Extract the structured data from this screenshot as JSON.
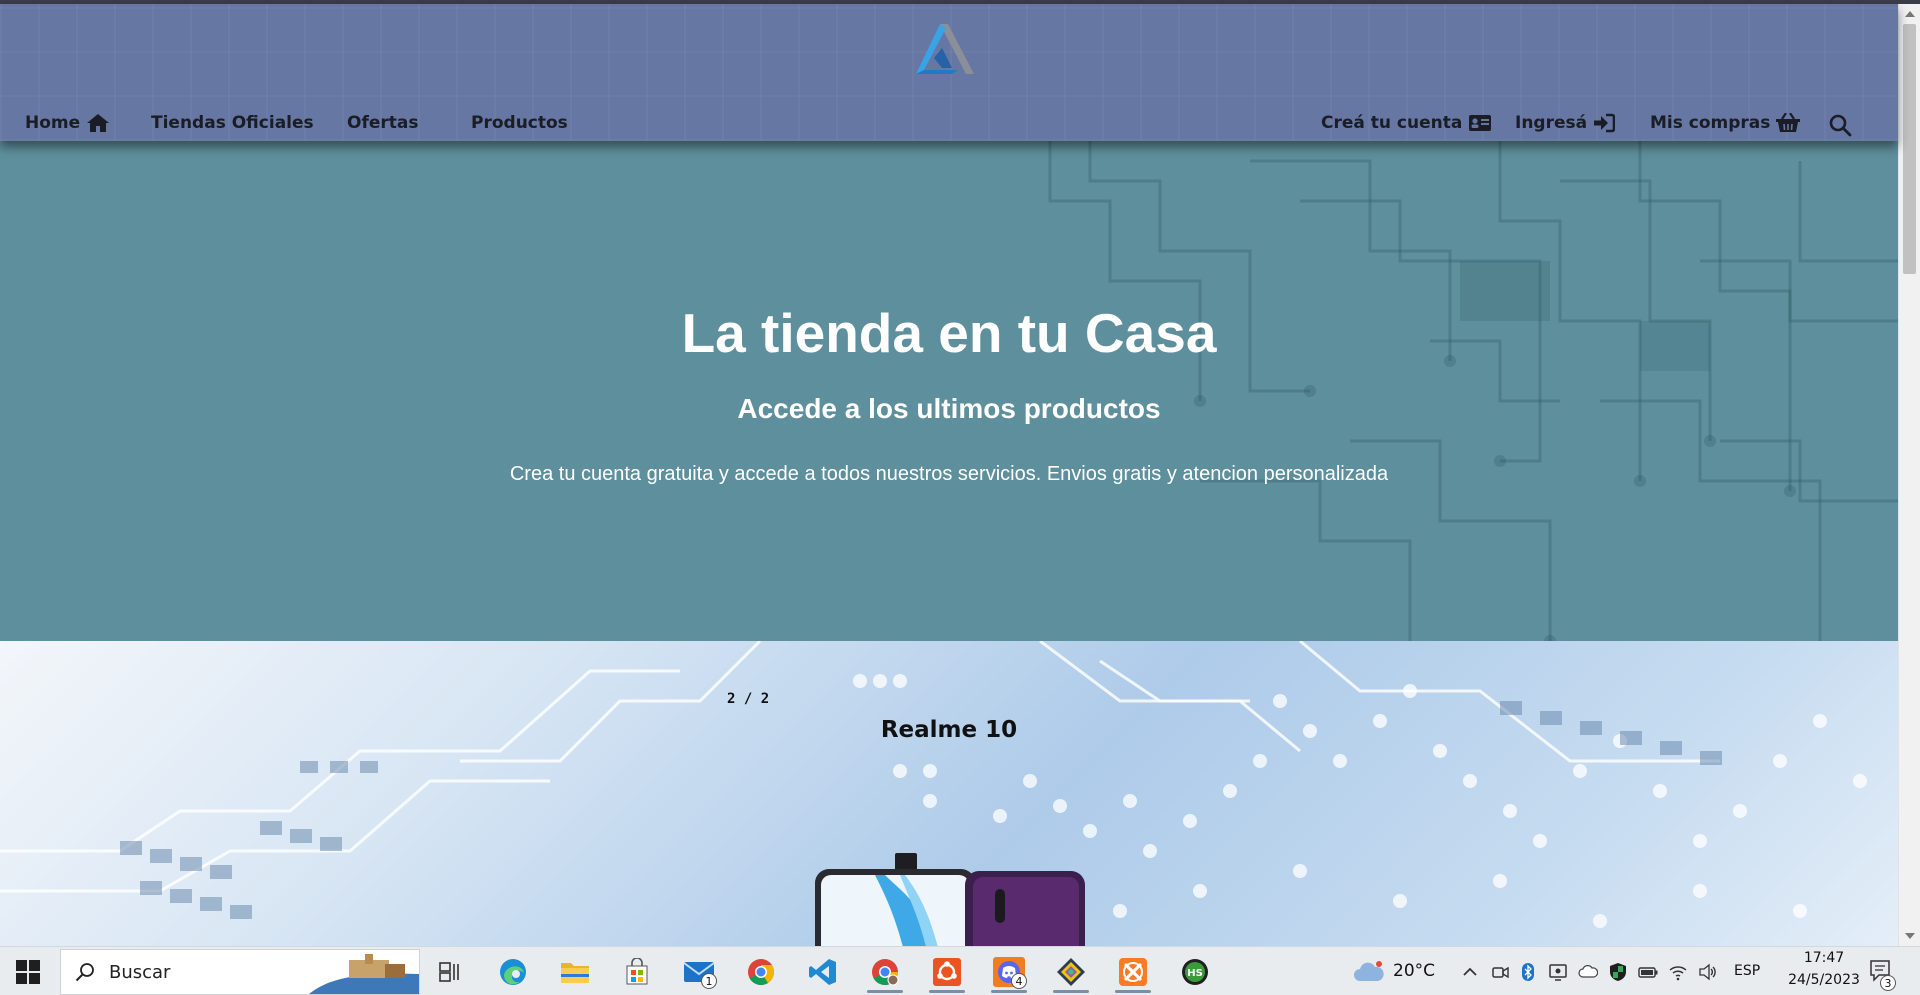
{
  "nav": {
    "home": "Home",
    "official_stores": "Tiendas Oficiales",
    "offers": "Ofertas",
    "products": "Productos",
    "create_account": "Creá tu cuenta",
    "login": "Ingresá",
    "my_purchases": "Mis compras"
  },
  "hero": {
    "title": "La tienda en tu Casa",
    "subtitle": "Accede a los ultimos productos",
    "text": "Crea tu cuenta gratuita y accede a todos nuestros servicios. Envios gratis y atencion personalizada"
  },
  "carousel": {
    "counter": "2 / 2",
    "product_title": "Realme 10"
  },
  "taskbar": {
    "search_placeholder": "Buscar",
    "mail_badge": "1",
    "discord_badge": "4",
    "weather": "20°C",
    "language": "ESP",
    "time": "17:47",
    "date": "24/5/2023",
    "notifications_badge": "3"
  },
  "colors": {
    "header_bg": "#6677a3",
    "hero_bg": "#5e8f9c",
    "nav_text": "#1b1d26"
  }
}
